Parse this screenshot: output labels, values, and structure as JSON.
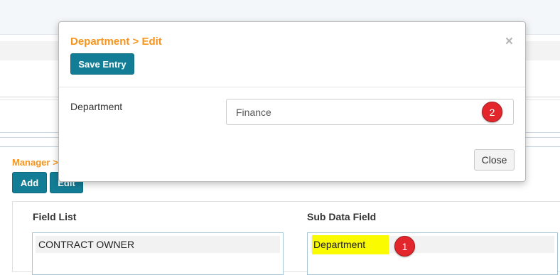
{
  "background": {
    "breadcrumb": "Manager >",
    "add_label": "Add",
    "edit_label": "Edit",
    "field_list_title": "Field List",
    "sub_data_field_title": "Sub Data Field",
    "field_list_items": [
      "CONTRACT OWNER"
    ],
    "sub_data_field_items": [
      "Department"
    ]
  },
  "modal": {
    "title": "Department > Edit",
    "save_label": "Save Entry",
    "close_x": "×",
    "field_label": "Department",
    "field_value": "Finance",
    "close_label": "Close"
  },
  "markers": [
    "1",
    "2"
  ],
  "colors": {
    "accent_orange": "#f7941d",
    "button_teal": "#137d96",
    "highlight_yellow": "#fbfb00",
    "marker_red": "#e3262b"
  }
}
